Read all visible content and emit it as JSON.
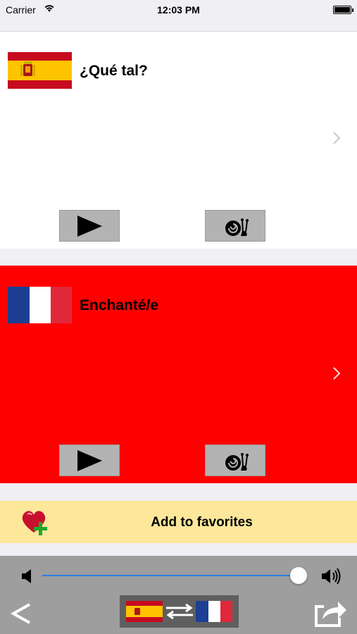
{
  "status_bar": {
    "carrier": "Carrier",
    "time": "12:03 PM",
    "icons": [
      "wifi-icon",
      "battery-icon"
    ]
  },
  "source_card": {
    "flag": "spain-flag",
    "phrase": "¿Qué tal?",
    "background": "#ffffff"
  },
  "target_card": {
    "flag": "france-flag",
    "phrase": "Enchanté/e",
    "background": "#ff0000"
  },
  "buttons": {
    "play_icon": "play-icon",
    "slow_icon": "snail-icon",
    "chevron_icon": "chevron-right-icon"
  },
  "favorites": {
    "label": "Add to favorites",
    "icon": "heart-plus-icon",
    "background": "#fce79b"
  },
  "toolbar": {
    "volume": 0.95,
    "back_icon": "back-chevron-icon",
    "swap_icon": "swap-languages-icon",
    "share_icon": "share-icon",
    "slider_color": "#2f7de1"
  }
}
